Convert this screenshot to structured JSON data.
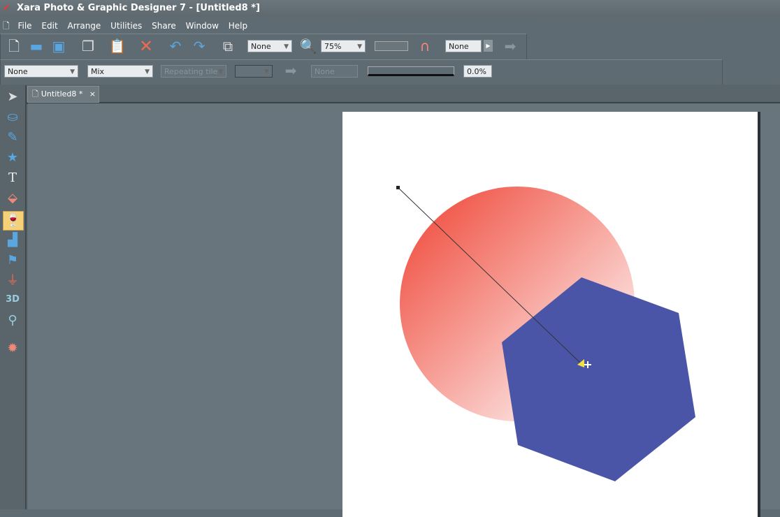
{
  "window": {
    "title": "Xara Photo & Graphic Designer 7 - [Untitled8 *]"
  },
  "menu": [
    "File",
    "Edit",
    "Arrange",
    "Utilities",
    "Share",
    "Window",
    "Help"
  ],
  "toolbar1": {
    "quality_select": "None",
    "zoom_select": "75%",
    "name_select": "None"
  },
  "toolbar2": {
    "transparency_type": "None",
    "transparency_mode": "Mix",
    "tiling": "Repeating tile",
    "profile": "None",
    "transparency_value": "0.0%"
  },
  "tabs": [
    {
      "label": "Untitled8 *",
      "close": "×"
    }
  ],
  "tools": [
    "selector-icon",
    "photo-icon",
    "freehand-icon",
    "shape-icon",
    "text-icon",
    "fill-icon",
    "transparency-icon",
    "shadow-icon",
    "mould-icon",
    "blend-icon",
    "3d-icon",
    "zoom-icon",
    "live-effects-icon"
  ],
  "active_tool": "transparency-icon",
  "colors": {
    "circle_start": "#ee4030",
    "circle_end": "#ffffff",
    "hexagon": "#4a55a8"
  }
}
